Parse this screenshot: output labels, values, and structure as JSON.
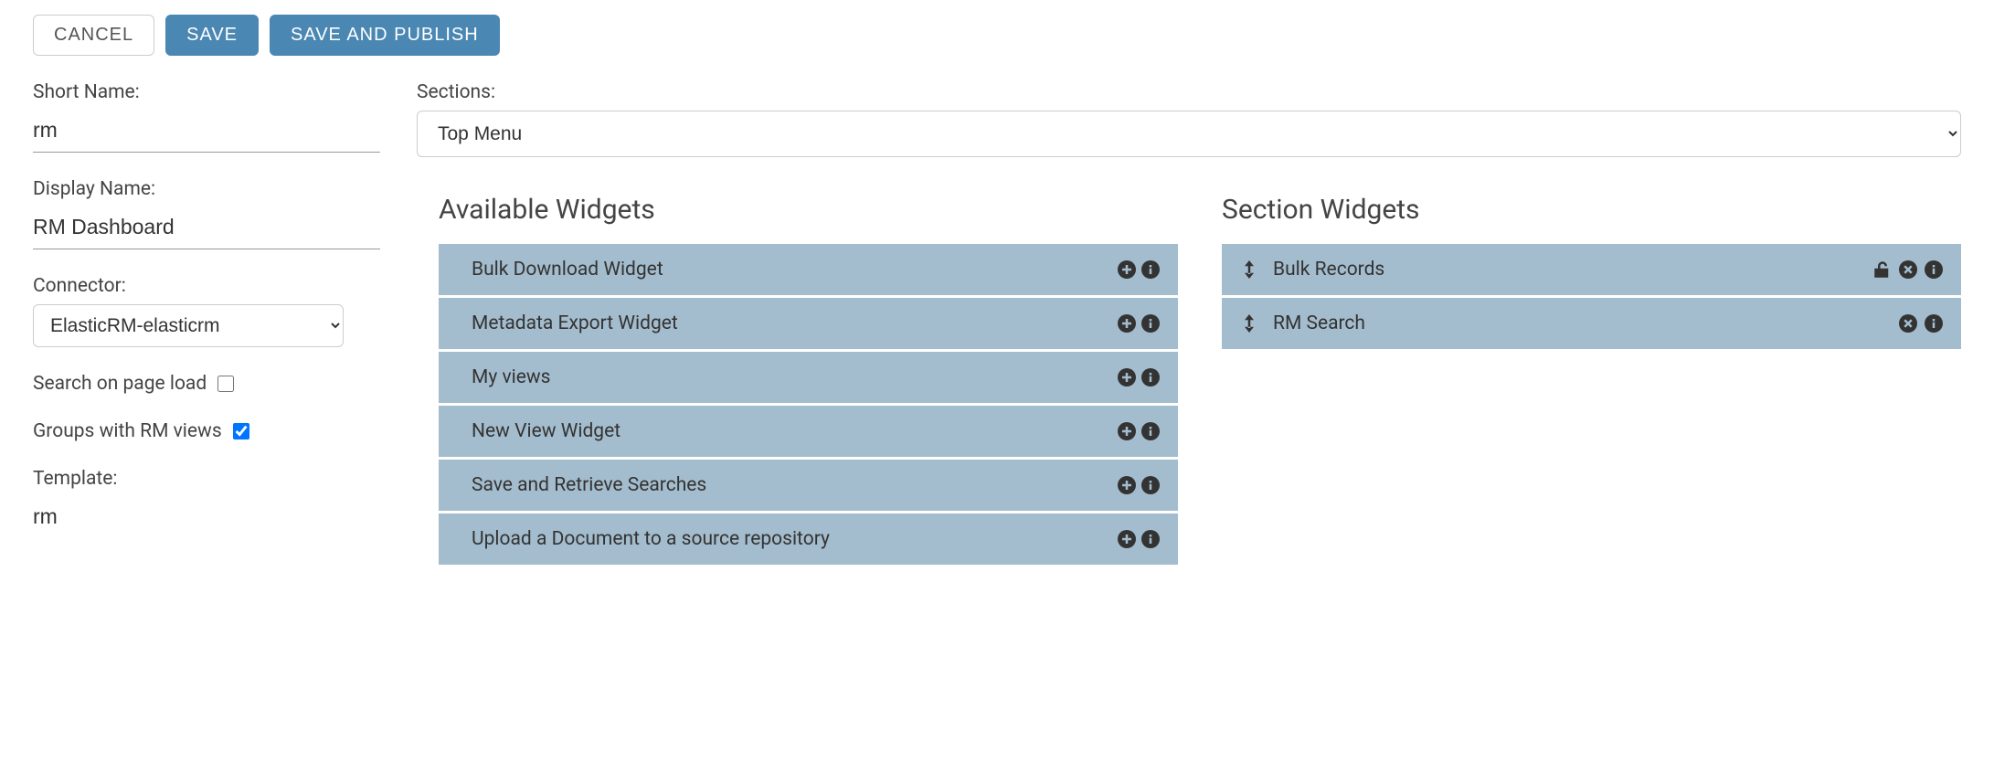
{
  "buttons": {
    "cancel": "CANCEL",
    "save": "SAVE",
    "save_publish": "SAVE AND PUBLISH"
  },
  "left": {
    "short_name_label": "Short Name:",
    "short_name_value": "rm",
    "display_name_label": "Display Name:",
    "display_name_value": "RM Dashboard",
    "connector_label": "Connector:",
    "connector_value": "ElasticRM-elasticrm",
    "search_on_load_label": "Search on page load",
    "search_on_load_checked": false,
    "groups_rm_label": "Groups with RM views",
    "groups_rm_checked": true,
    "template_label": "Template:",
    "template_value": "rm"
  },
  "right": {
    "sections_label": "Sections:",
    "sections_value": "Top Menu",
    "available_heading": "Available Widgets",
    "section_heading": "Section Widgets",
    "available_widgets": [
      "Bulk Download Widget",
      "Metadata Export Widget",
      "My views",
      "New View Widget",
      "Save and Retrieve Searches",
      "Upload a Document to a source repository"
    ],
    "section_widgets": [
      {
        "name": "Bulk Records",
        "locked": false,
        "hasLock": true
      },
      {
        "name": "RM Search",
        "locked": false,
        "hasLock": false
      }
    ]
  }
}
